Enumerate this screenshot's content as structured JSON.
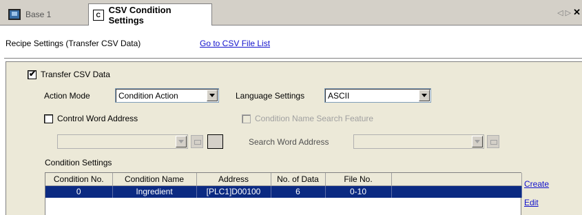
{
  "tabs": [
    {
      "label": "Base 1",
      "icon": "monitor-icon"
    },
    {
      "label": "CSV Condition Settings",
      "icon": "csv-file-icon"
    }
  ],
  "tab_nav": {
    "prev": "◁",
    "next": "▷",
    "close": "✕"
  },
  "header": {
    "title": "Recipe Settings (Transfer CSV Data)",
    "link": "Go to CSV File List"
  },
  "transfer": {
    "label": "Transfer CSV Data",
    "checked": true
  },
  "action_mode": {
    "label": "Action Mode",
    "value": "Condition Action"
  },
  "language": {
    "label": "Language Settings",
    "value": "ASCII"
  },
  "control_word": {
    "label": "Control Word Address",
    "checked": false
  },
  "condition_search": {
    "label": "Condition Name Search Feature",
    "checked": false
  },
  "search_word": {
    "label": "Search Word Address"
  },
  "condition_settings": {
    "label": "Condition Settings",
    "columns": [
      "Condition No.",
      "Condition Name",
      "Address",
      "No. of Data",
      "File No.",
      ""
    ],
    "rows": [
      [
        "0",
        "Ingredient",
        "[PLC1]D00100",
        "6",
        "0-10",
        ""
      ]
    ]
  },
  "actions": {
    "create": "Create",
    "edit": "Edit"
  }
}
